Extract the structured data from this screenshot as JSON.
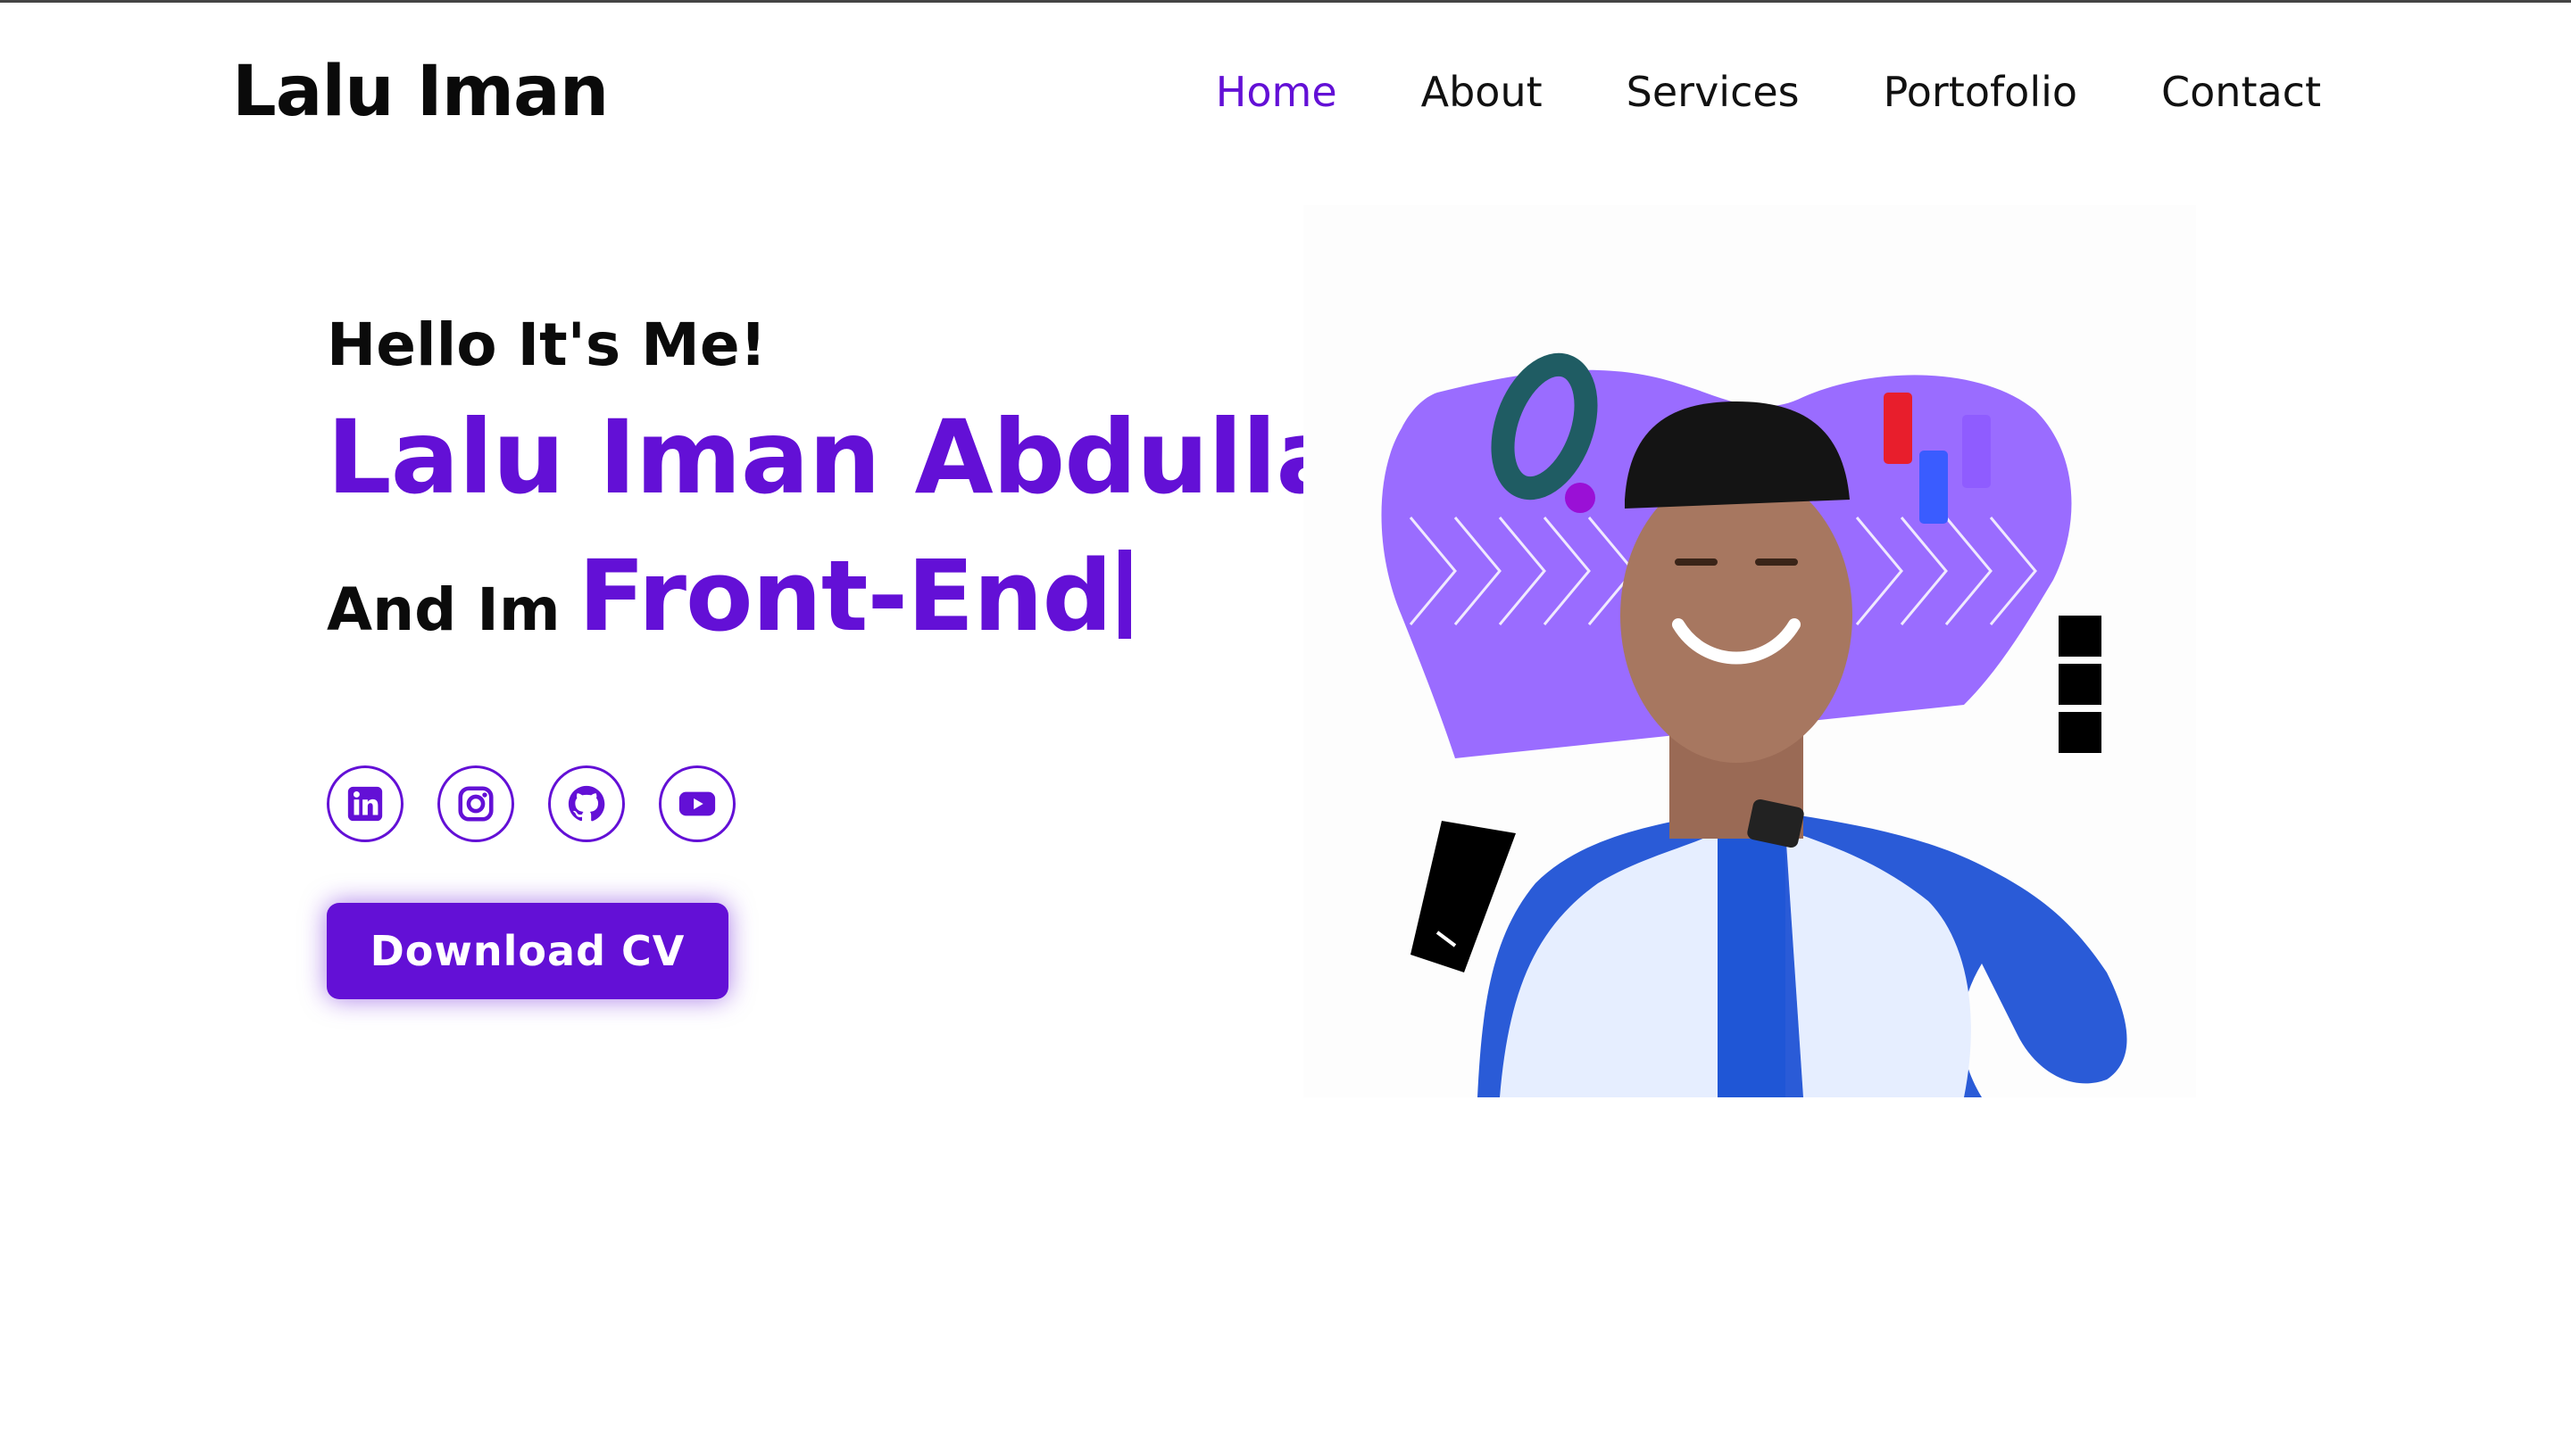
{
  "header": {
    "logo": "Lalu Iman",
    "nav": [
      {
        "label": "Home",
        "active": true
      },
      {
        "label": "About",
        "active": false
      },
      {
        "label": "Services",
        "active": false
      },
      {
        "label": "Portofolio",
        "active": false
      },
      {
        "label": "Contact",
        "active": false
      }
    ]
  },
  "hero": {
    "greeting": "Hello It's Me!",
    "name": "Lalu Iman Abdullah",
    "role_prefix": "And Im",
    "role": "Front-End",
    "socials": [
      {
        "icon": "linkedin-icon"
      },
      {
        "icon": "instagram-icon"
      },
      {
        "icon": "github-icon"
      },
      {
        "icon": "youtube-icon"
      }
    ],
    "cta_label": "Download CV"
  },
  "colors": {
    "accent": "#6310d6",
    "blob": "#9a6cff",
    "text": "#0b0b0b"
  }
}
